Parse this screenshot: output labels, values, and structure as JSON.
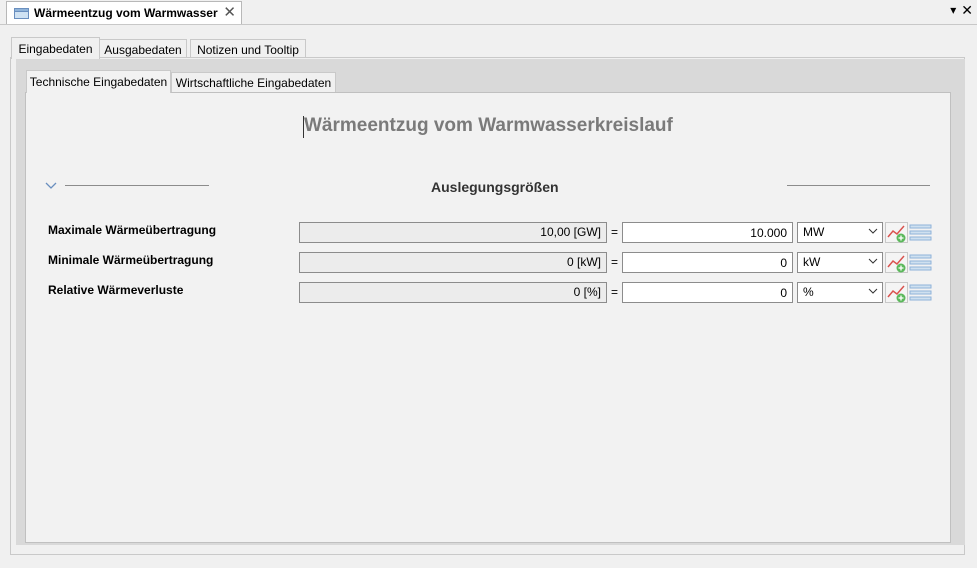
{
  "window": {
    "doc_tab_title": "Wärmeentzug vom Warmwasser",
    "strip_dropdown_glyph": "▾",
    "strip_close_glyph": "✕"
  },
  "tabs": [
    {
      "label": "Eingabedaten",
      "active": true
    },
    {
      "label": "Ausgabedaten",
      "active": false
    },
    {
      "label": "Notizen und Tooltip",
      "active": false
    }
  ],
  "subtabs": [
    {
      "label": "Technische Eingabedaten",
      "active": true
    },
    {
      "label": "Wirtschaftliche Eingabedaten",
      "active": false
    }
  ],
  "content": {
    "title": "Wärmeentzug vom Warmwasserkreislauf",
    "section_title": "Auslegungsgrößen",
    "equals": "=",
    "rows": [
      {
        "label": "Maximale Wärmeübertragung",
        "readonly": "10,00 [GW]",
        "value": "10.000",
        "unit": "MW"
      },
      {
        "label": "Minimale Wärmeübertragung",
        "readonly": "0 [kW]",
        "value": "0",
        "unit": "kW"
      },
      {
        "label": "Relative Wärmeverluste",
        "readonly": "0 [%]",
        "value": "0",
        "unit": "%"
      }
    ]
  },
  "icons": {
    "doc_tab": "window-icon",
    "close": "close-icon",
    "section_toggle": "chevron-down-icon",
    "chart": "add-chart-icon",
    "list": "list-icon"
  },
  "colors": {
    "title_gray": "#7a7a7a",
    "chart_red": "#d9534f",
    "chart_green": "#5cb85c",
    "list_blue": "#8fb3d9"
  }
}
